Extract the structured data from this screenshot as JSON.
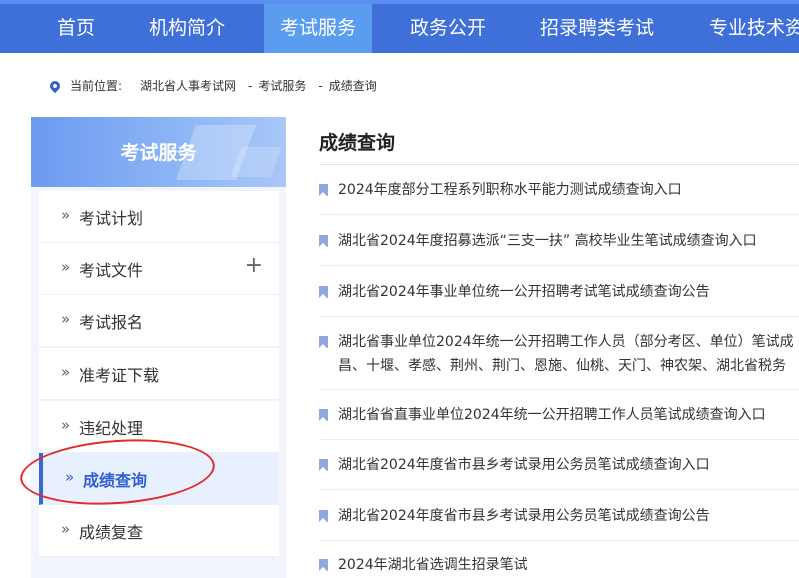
{
  "nav": {
    "items": [
      {
        "label": "首页",
        "active": false
      },
      {
        "label": "机构简介",
        "active": false
      },
      {
        "label": "考试服务",
        "active": true
      },
      {
        "label": "政务公开",
        "active": false
      },
      {
        "label": "招录聘类考试",
        "active": false
      },
      {
        "label": "专业技术资",
        "active": false
      }
    ]
  },
  "breadcrumb": {
    "prefix": "当前位置:",
    "items": [
      "湖北省人事考试网",
      "考试服务",
      "成绩查询"
    ],
    "separator": "-"
  },
  "sidebar": {
    "header": "考试服务",
    "items": [
      {
        "label": "考试计划",
        "expandable": false,
        "active": false
      },
      {
        "label": "考试文件",
        "expandable": true,
        "active": false
      },
      {
        "label": "考试报名",
        "expandable": false,
        "active": false
      },
      {
        "label": "准考证下载",
        "expandable": false,
        "active": false
      },
      {
        "label": "违纪处理",
        "expandable": false,
        "active": false
      },
      {
        "label": "成绩查询",
        "expandable": false,
        "active": true
      },
      {
        "label": "成绩复查",
        "expandable": false,
        "active": false
      }
    ],
    "arrow": "»",
    "plus": "+"
  },
  "main": {
    "title": "成绩查询",
    "items": [
      {
        "line1": "2024年度部分工程系列职称水平能力测试成绩查询入口"
      },
      {
        "line1": "湖北省2024年度招募选派“三支一扶” 高校毕业生笔试成绩查询入口"
      },
      {
        "line1": "湖北省2024年事业单位统一公开招聘考试笔试成绩查询公告"
      },
      {
        "line1": "湖北省事业单位2024年统一公开招聘工作人员（部分考区、单位）笔试成",
        "line2": "昌、十堰、孝感、荆州、荆门、恩施、仙桃、天门、神农架、湖北省税务"
      },
      {
        "line1": "湖北省省直事业单位2024年统一公开招聘工作人员笔试成绩查询入口"
      },
      {
        "line1": "湖北省2024年度省市县乡考试录用公务员笔试成绩查询入口"
      },
      {
        "line1": "湖北省2024年度省市县乡考试录用公务员笔试成绩查询公告"
      },
      {
        "line1": "2024年湖北省选调生招录笔试"
      }
    ]
  },
  "colors": {
    "nav_bg": "#3f6fd8",
    "nav_active": "#5a9cf0",
    "accent": "#2f5fd5",
    "annotation": "#e02b2b"
  }
}
